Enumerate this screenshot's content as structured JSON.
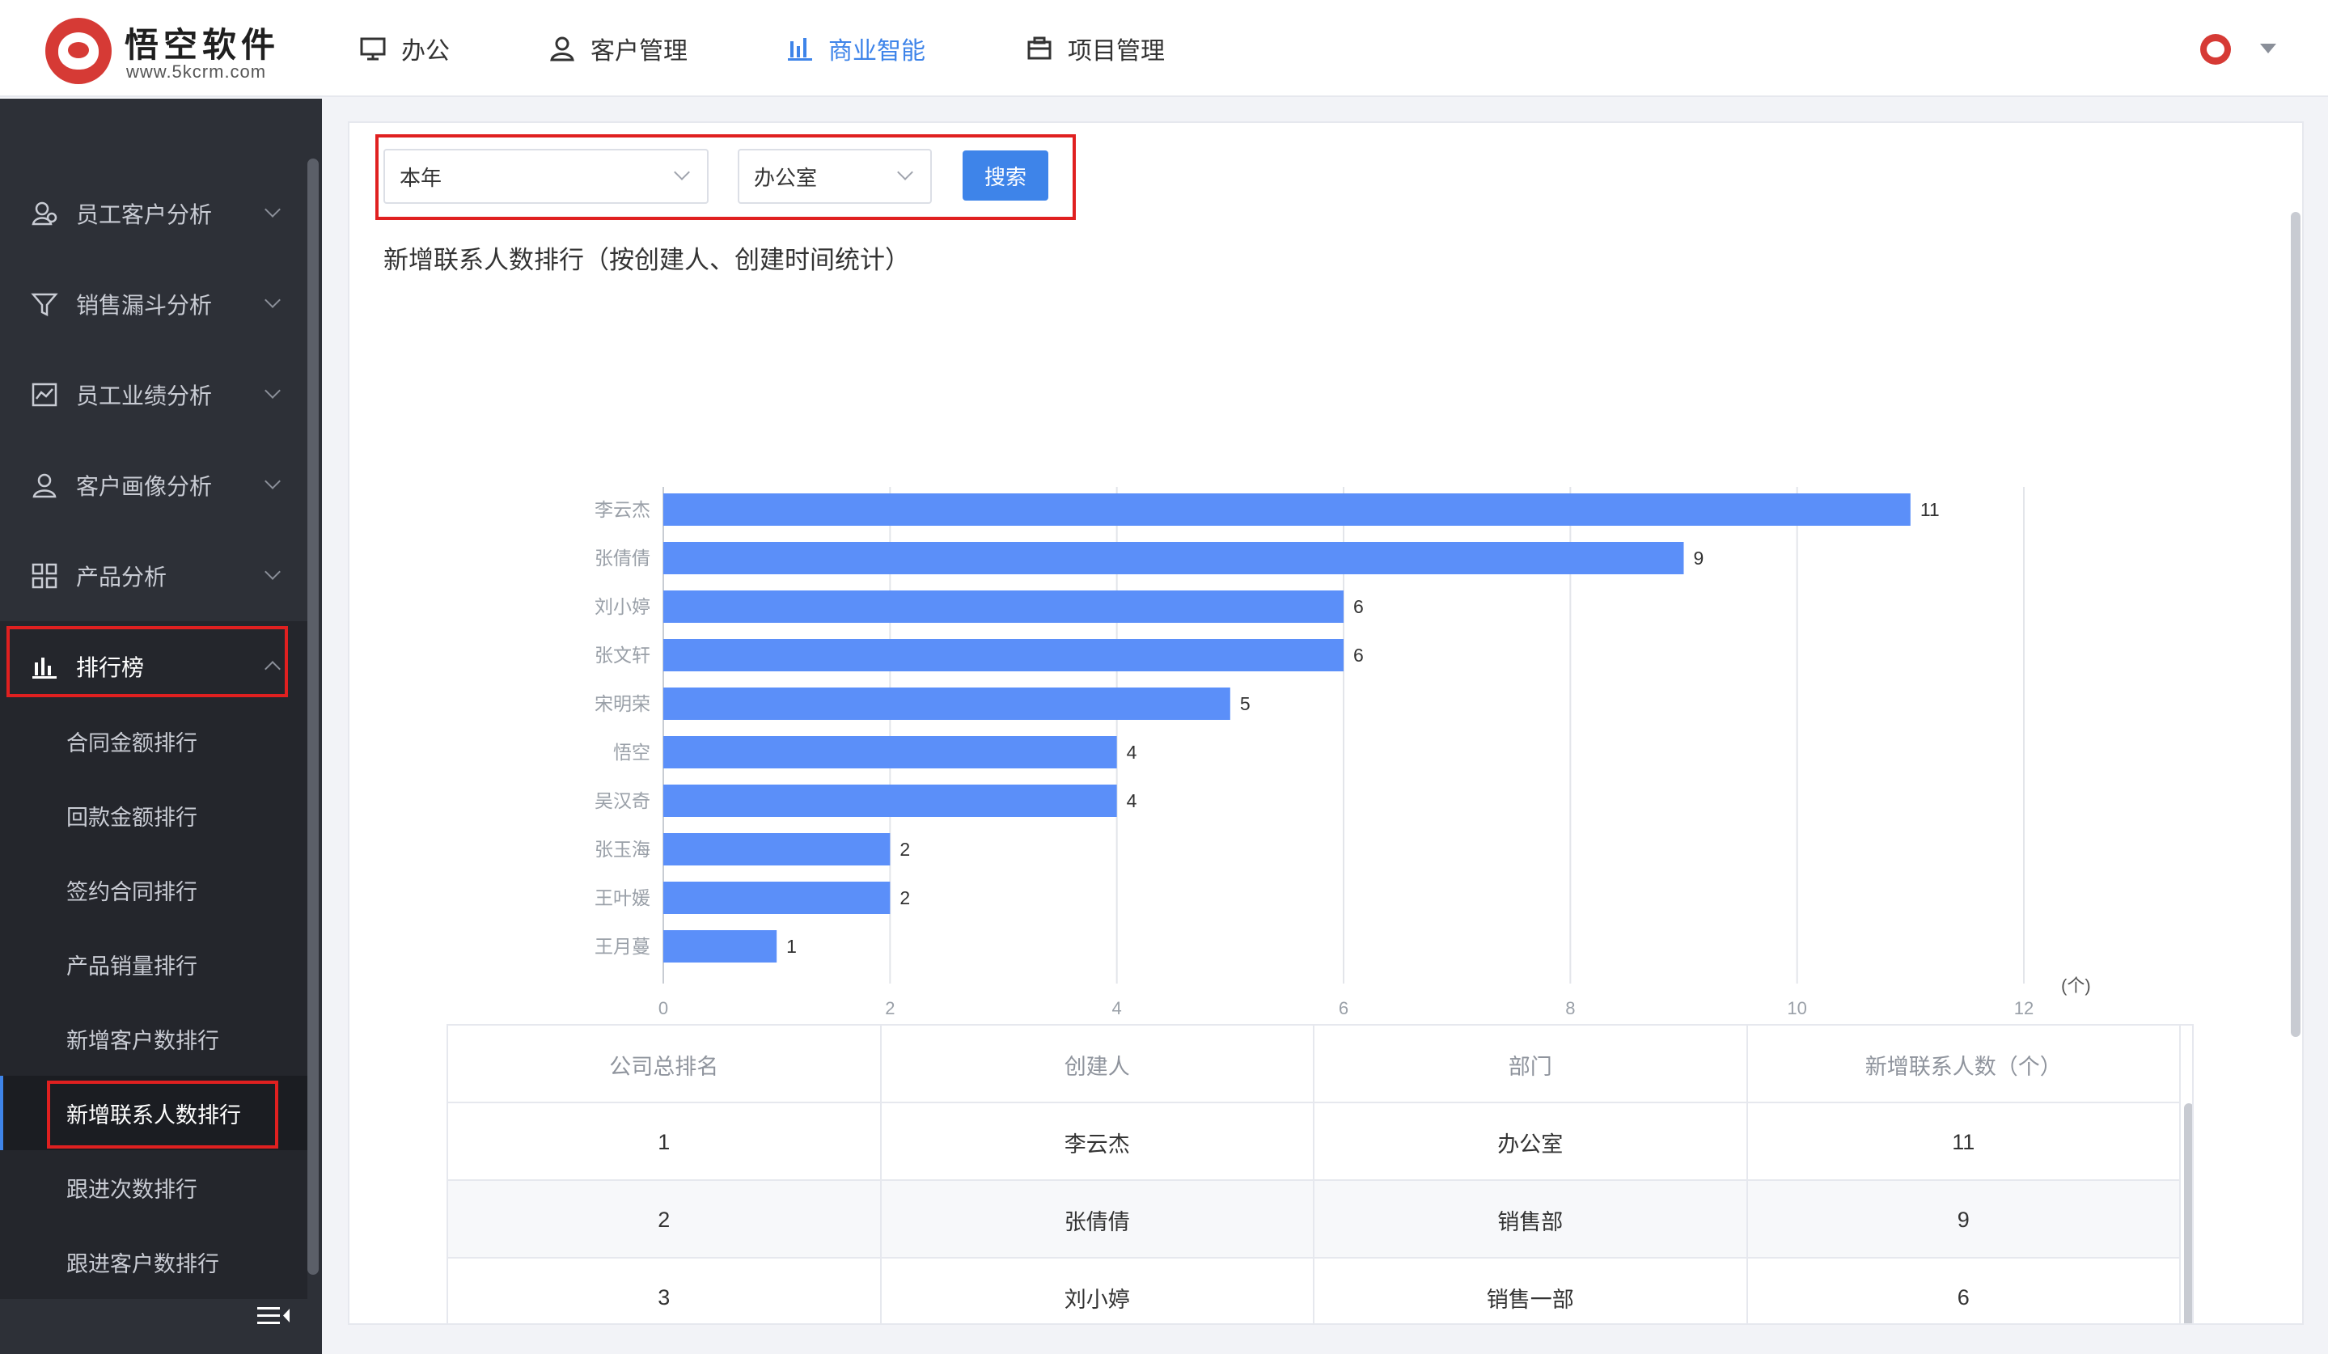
{
  "brand": {
    "title": "悟空软件",
    "subtitle": "www.5kcrm.com"
  },
  "nav": {
    "items": [
      {
        "label": "办公",
        "icon": "monitor-icon"
      },
      {
        "label": "客户管理",
        "icon": "user-icon"
      },
      {
        "label": "商业智能",
        "icon": "bar-chart-icon",
        "active": true
      },
      {
        "label": "项目管理",
        "icon": "briefcase-icon"
      }
    ]
  },
  "sidebar": {
    "items": [
      {
        "label": "员工客户分析",
        "icon": "users-icon"
      },
      {
        "label": "销售漏斗分析",
        "icon": "filter-icon"
      },
      {
        "label": "员工业绩分析",
        "icon": "trend-icon"
      },
      {
        "label": "客户画像分析",
        "icon": "portrait-icon"
      },
      {
        "label": "产品分析",
        "icon": "grid-icon"
      },
      {
        "label": "排行榜",
        "icon": "ranking-icon",
        "open": true
      }
    ],
    "subitems": [
      {
        "label": "合同金额排行"
      },
      {
        "label": "回款金额排行"
      },
      {
        "label": "签约合同排行"
      },
      {
        "label": "产品销量排行"
      },
      {
        "label": "新增客户数排行"
      },
      {
        "label": "新增联系人数排行",
        "active": true
      },
      {
        "label": "跟进次数排行"
      },
      {
        "label": "跟进客户数排行"
      }
    ]
  },
  "filters": {
    "period": "本年",
    "department": "办公室",
    "search_label": "搜索"
  },
  "chart_title": "新增联系人数排行（按创建人、创建时间统计）",
  "chart_data": {
    "type": "bar",
    "orientation": "horizontal",
    "categories": [
      "李云杰",
      "张倩倩",
      "刘小婷",
      "张文轩",
      "宋明荣",
      "悟空",
      "吴汉奇",
      "张玉海",
      "王叶媛",
      "王月蔓"
    ],
    "values": [
      11,
      9,
      6,
      6,
      5,
      4,
      4,
      2,
      2,
      1
    ],
    "unit": "(个)",
    "xlim": [
      0,
      12
    ],
    "xticks": [
      0,
      2,
      4,
      6,
      8,
      10,
      12
    ],
    "bar_color": "#5b8ff9",
    "grid": true
  },
  "table": {
    "headers": [
      "公司总排名",
      "创建人",
      "部门",
      "新增联系人数（个）"
    ],
    "rows": [
      [
        "1",
        "李云杰",
        "办公室",
        "11"
      ],
      [
        "2",
        "张倩倩",
        "销售部",
        "9"
      ],
      [
        "3",
        "刘小婷",
        "销售一部",
        "6"
      ]
    ]
  }
}
